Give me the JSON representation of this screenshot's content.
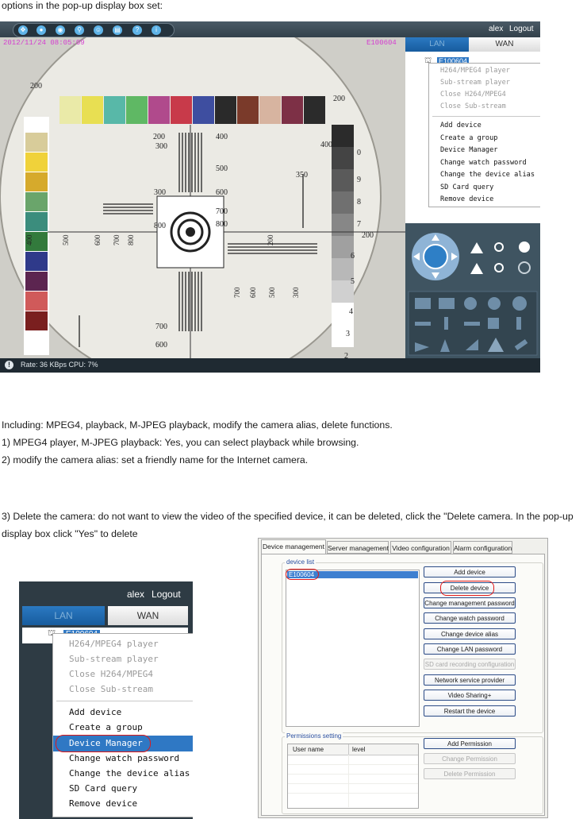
{
  "doc": {
    "intro_text": "options in the pop-up display box set:",
    "para_including": "Including: MPEG4, playback, M-JPEG playback, modify the camera alias, delete functions.",
    "item_1": "1) MPEG4 player, M-JPEG playback: Yes, you can select playback while browsing.",
    "item_2": "2) modify the camera alias: set a friendly name for the Internet camera.",
    "item_3": "3) Delete the camera: do not want to view the video of the specified device, it can be deleted, click the \"Delete camera. In the pop-up display box click \"Yes\" to delete"
  },
  "client": {
    "user": "alex",
    "logout": "Logout",
    "tabs": {
      "lan": "LAN",
      "wan": "WAN"
    },
    "device_node": "E100604",
    "status": "Rate: 36 KBps  CPU:   7%",
    "chart_numbers": [
      "200",
      "200",
      "200",
      "400",
      "500",
      "600",
      "700",
      "800",
      "300",
      "350",
      "0",
      "9",
      "8",
      "7",
      "6",
      "5",
      "4",
      "3",
      "2",
      "200",
      "800",
      "700",
      "600",
      "500",
      "400",
      "300",
      "300",
      "400",
      "500",
      "600",
      "700",
      "800",
      "700",
      "600",
      "500",
      "300",
      "200"
    ],
    "menu": {
      "disabled": [
        "H264/MPEG4 player",
        "Sub-stream player",
        "Close H264/MPEG4",
        "Close Sub-stream"
      ],
      "enabled": [
        "Add device",
        "Create a group",
        "Device Manager",
        "Change watch password",
        "Change the device alias",
        "SD Card query",
        "Remove device"
      ]
    }
  },
  "dialog": {
    "tabs": [
      "Device management",
      "Server management",
      "Video configuration",
      "Alarm configuration"
    ],
    "device_list_label": "device list",
    "device_item": "E100604",
    "buttons": [
      {
        "label": "Add device",
        "enabled": true
      },
      {
        "label": "Delete device",
        "enabled": true
      },
      {
        "label": "Change management password",
        "enabled": true
      },
      {
        "label": "Change watch password",
        "enabled": true
      },
      {
        "label": "Change device alias",
        "enabled": true
      },
      {
        "label": "Change LAN password",
        "enabled": true
      },
      {
        "label": "SD card recording configuration",
        "enabled": false
      },
      {
        "label": "Network service provider",
        "enabled": true
      },
      {
        "label": "Video Sharing+",
        "enabled": true
      },
      {
        "label": "Restart the device",
        "enabled": true
      }
    ],
    "permissions_label": "Permissions setting",
    "columns": [
      "User name",
      "level"
    ],
    "perm_buttons": [
      {
        "label": "Add Permission",
        "enabled": true
      },
      {
        "label": "Change Permission",
        "enabled": false
      },
      {
        "label": "Delete Permission",
        "enabled": false
      }
    ]
  },
  "colors": {
    "accent_blue": "#2f78c4",
    "highlight_red": "#e01818",
    "panel_dark": "#2d3b45",
    "timestamp_magenta": "#d53fd0"
  }
}
